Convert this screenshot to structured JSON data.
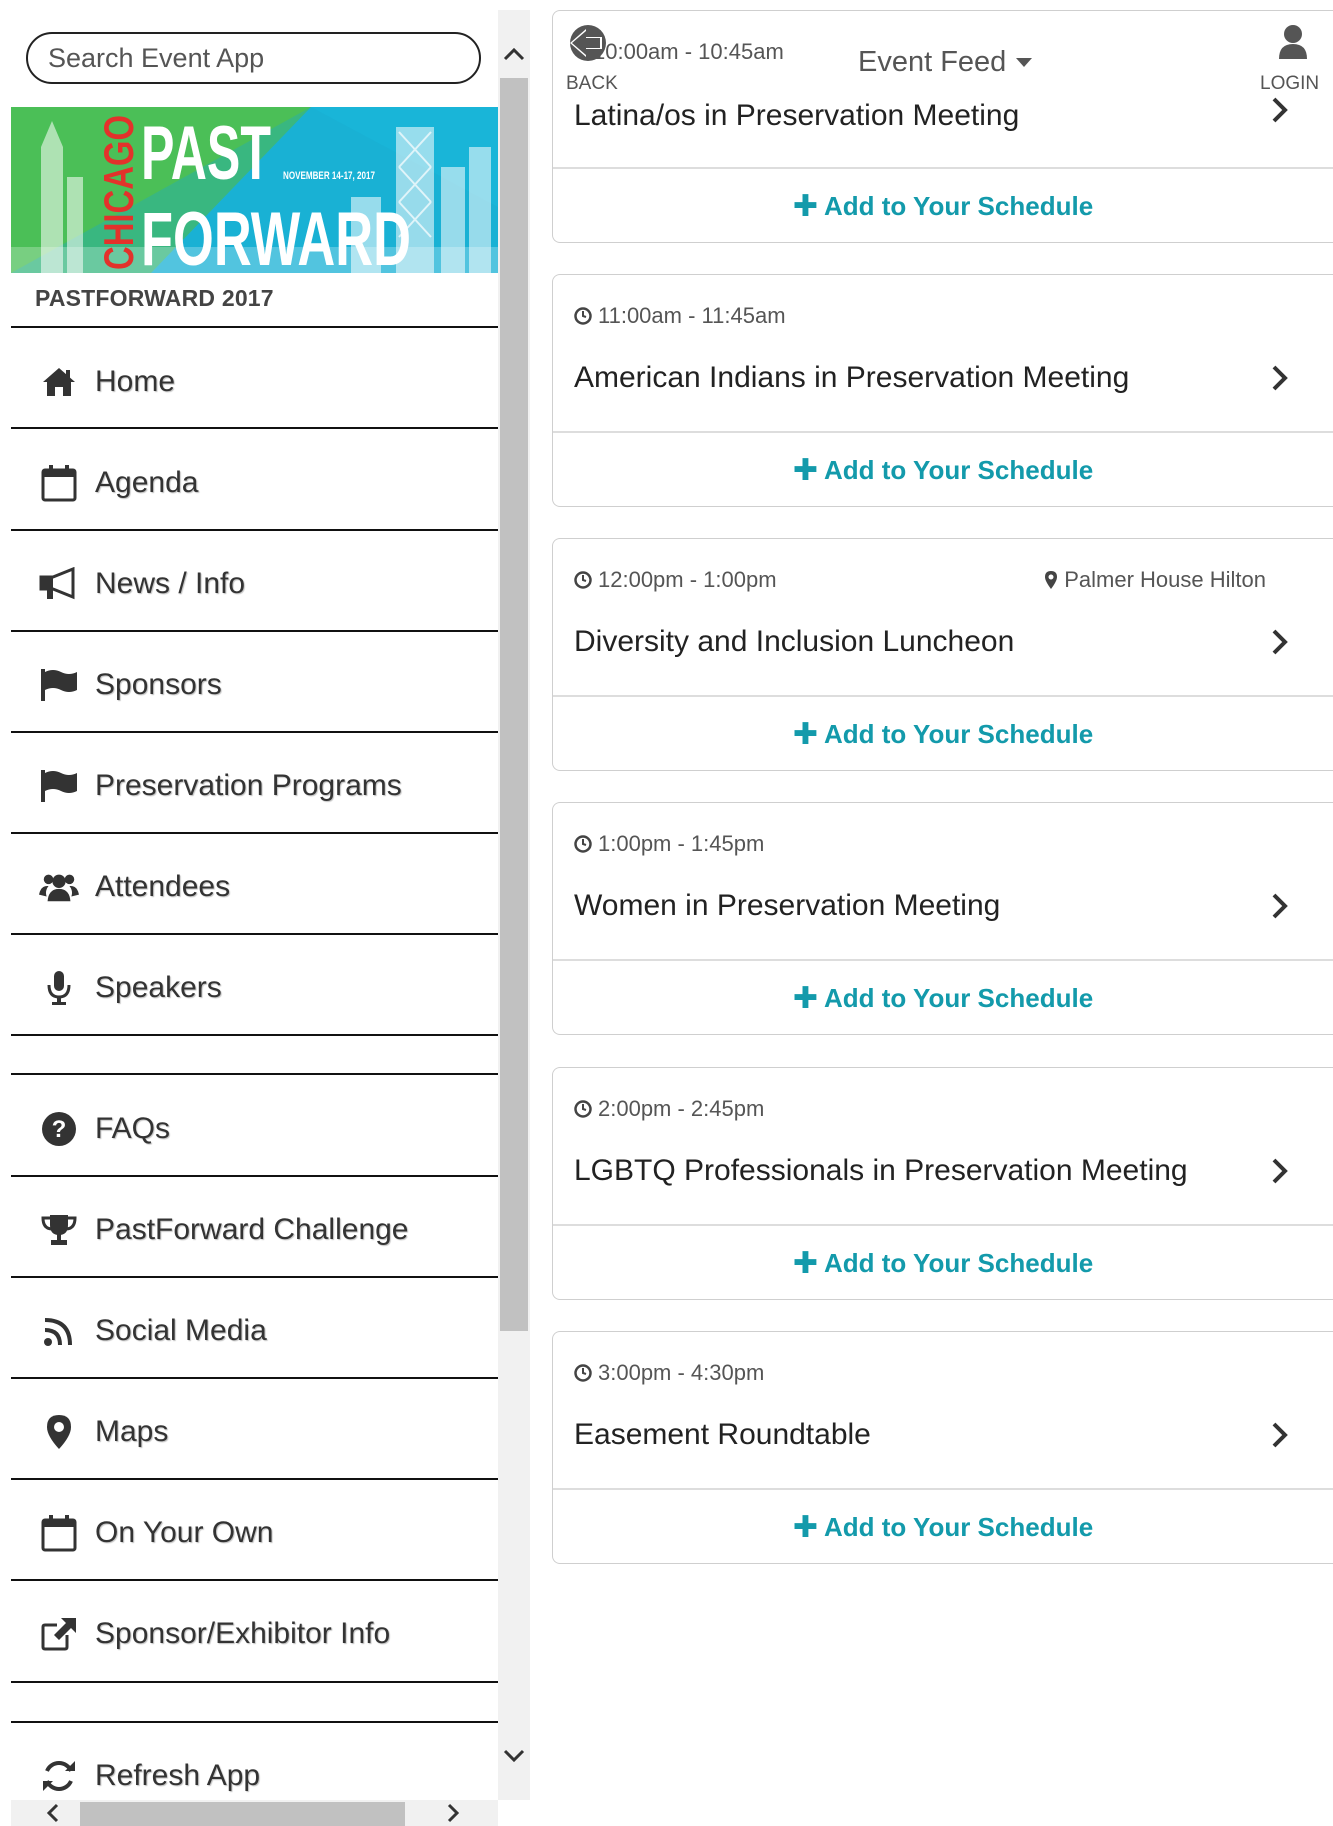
{
  "search": {
    "placeholder": "Search Event App"
  },
  "banner": {
    "city": "CHICAGO",
    "word1": "PAST",
    "word2": "FORWARD",
    "dates": "NOVEMBER 14-17, 2017"
  },
  "event_name": "PASTFORWARD 2017",
  "nav": [
    {
      "label": "Home",
      "icon": "home-icon"
    },
    {
      "label": "Agenda",
      "icon": "calendar-icon"
    },
    {
      "label": "News / Info",
      "icon": "megaphone-icon"
    },
    {
      "label": "Sponsors",
      "icon": "flag-icon"
    },
    {
      "label": "Preservation Programs",
      "icon": "flag-icon"
    },
    {
      "label": "Attendees",
      "icon": "users-icon"
    },
    {
      "label": "Speakers",
      "icon": "microphone-icon"
    },
    {
      "label": "FAQs",
      "icon": "question-circle-icon"
    },
    {
      "label": "PastForward Challenge",
      "icon": "trophy-icon"
    },
    {
      "label": "Social Media",
      "icon": "rss-icon"
    },
    {
      "label": "Maps",
      "icon": "map-marker-icon"
    },
    {
      "label": "On Your Own",
      "icon": "calendar-icon"
    },
    {
      "label": "Sponsor/Exhibitor Info",
      "icon": "external-link-icon"
    },
    {
      "label": "Refresh App",
      "icon": "refresh-icon"
    }
  ],
  "header": {
    "back_label": "BACK",
    "feed_title": "Event Feed",
    "login_label": "LOGIN"
  },
  "sessions": [
    {
      "time": "10:00am - 10:45am",
      "location": "",
      "title": "Latina/os in Preservation Meeting",
      "add_label": "Add to Your Schedule"
    },
    {
      "time": "11:00am - 11:45am",
      "location": "",
      "title": "American Indians in Preservation Meeting",
      "add_label": "Add to Your Schedule"
    },
    {
      "time": "12:00pm - 1:00pm",
      "location": "Palmer House Hilton",
      "title": "Diversity and Inclusion Luncheon",
      "add_label": "Add to Your Schedule"
    },
    {
      "time": "1:00pm - 1:45pm",
      "location": "",
      "title": "Women in Preservation Meeting",
      "add_label": "Add to Your Schedule"
    },
    {
      "time": "2:00pm - 2:45pm",
      "location": "",
      "title": "LGBTQ Professionals in Preservation Meeting",
      "add_label": "Add to Your Schedule"
    },
    {
      "time": "3:00pm - 4:30pm",
      "location": "",
      "title": "Easement Roundtable",
      "add_label": "Add to Your Schedule"
    }
  ],
  "colors": {
    "accent": "#139aab",
    "banner_blue": "#19b5d8",
    "banner_green": "#4bbf57"
  }
}
